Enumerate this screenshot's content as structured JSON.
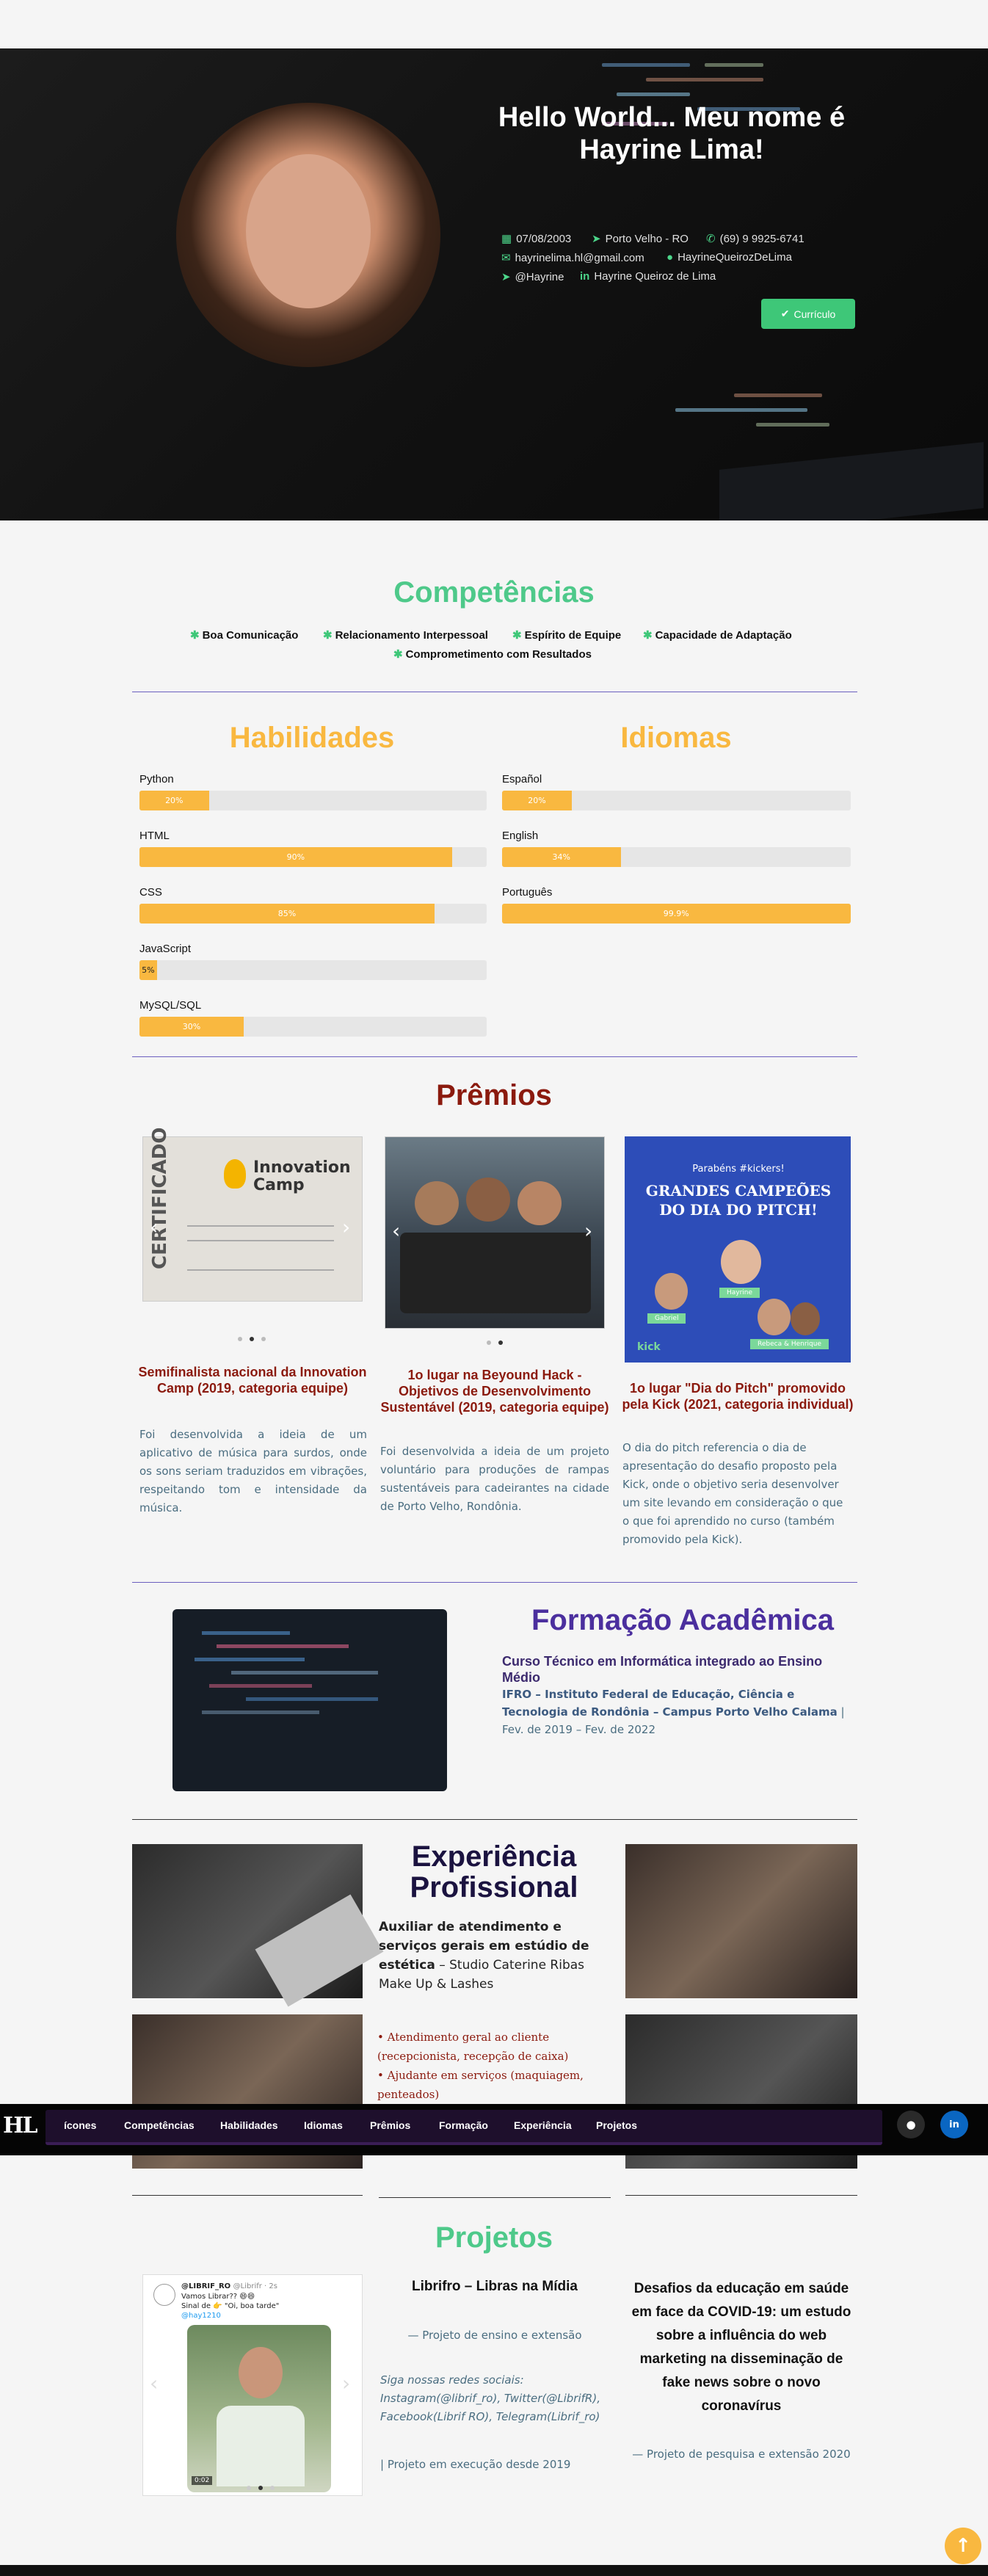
{
  "hero": {
    "title": "Hello World... Meu nome é Hayrine Lima!",
    "birth": "07/08/2003",
    "location": "Porto Velho - RO",
    "phone": "(69) 9 9925-6741",
    "email": "hayrinelima.hl@gmail.com",
    "github": "HayrineQueirozDeLima",
    "telegram": "@Hayrine",
    "linkedin": "Hayrine Queiroz de Lima",
    "cv_label": "Currículo",
    "colors": {
      "accent": "#3ec778"
    },
    "icons": [
      "calendar-icon",
      "send-icon",
      "phone-icon",
      "mail-icon",
      "github-icon",
      "telegram-icon",
      "linkedin-icon",
      "check-icon"
    ]
  },
  "competencias": {
    "title": "Competências",
    "items": [
      "Boa Comunicação",
      "Relacionamento Interpessoal",
      "Espírito de Equipe",
      "Capacidade de Adaptação",
      "Comprometimento com Resultados"
    ],
    "icon": "gear-icon",
    "color": "#4ec98a"
  },
  "habilidades": {
    "title": "Habilidades",
    "color": "#f9b840",
    "items": [
      {
        "name": "Python",
        "label": "20%",
        "percent": 20
      },
      {
        "name": "HTML",
        "label": "90%",
        "percent": 90
      },
      {
        "name": "CSS",
        "label": "85%",
        "percent": 85
      },
      {
        "name": "JavaScript",
        "label": "5%",
        "percent": 5
      },
      {
        "name": "MySQL/SQL",
        "label": "30%",
        "percent": 30
      }
    ]
  },
  "idiomas": {
    "title": "Idiomas",
    "items": [
      {
        "name": "Español",
        "label": "20%",
        "percent": 20
      },
      {
        "name": "English",
        "label": "34%",
        "percent": 34
      },
      {
        "name": "Português",
        "label": "99.9%",
        "percent": 99.9
      }
    ]
  },
  "premios": {
    "title": "Prêmios",
    "color": "#8b1a0e",
    "cards": [
      {
        "title": "Semifinalista nacional da Innovation Camp (2019, categoria equipe)",
        "text": "Foi desenvolvida a ideia de um aplicativo de música para surdos, onde os sons seriam traduzidos em vibrações, respeitando tom e intensidade da música.",
        "image_caption": "Innovation Camp",
        "image_side": "CERTIFICADO"
      },
      {
        "title": "1o lugar na Beyound Hack - Objetivos de Desenvolvimento Sustentável (2019, categoria equipe)",
        "text": "Foi desenvolvida a ideia de um projeto voluntário para produções de rampas sustentáveis para cadeirantes na cidade de Porto Velho, Rondônia."
      },
      {
        "title": "1o lugar \"Dia do Pitch\" promovido pela Kick (2021, categoria individual)",
        "text": "O dia do pitch referencia o dia de apresentação do desafio proposto pela Kick, onde o objetivo seria desenvolver um site levando em consideração o que o que foi aprendido no curso (também promovido pela Kick).",
        "image_top": "Parabéns #kickers!",
        "image_heading": "GRANDES CAMPEÕES DO DIA DO PITCH!",
        "image_brand": "kick",
        "image_badges": [
          "Hayrine",
          "Gabriel",
          "Rebeca & Henrique"
        ]
      }
    ]
  },
  "formacao": {
    "title": "Formação Acadêmica",
    "color": "#4b2f9e",
    "course": "Curso Técnico em Informática integrado ao Ensino Médio",
    "institution": "IFRO – Instituto Federal de Educação, Ciência e Tecnologia de Rondônia – Campus Porto Velho Calama",
    "period": " | Fev. de 2019 – Fev. de 2022"
  },
  "experiencia": {
    "title": "Experiência Profissional",
    "role": "Auxiliar de atendimento e serviços gerais em estúdio de estética",
    "company": " – Studio Caterine Ribas Make Up & Lashes",
    "tasks": [
      "Atendimento geral ao cliente (recepcionista, recepção de caixa)",
      "Ajudante em serviços (maquiagem, penteados)"
    ]
  },
  "nav": {
    "logo": "HL",
    "items": [
      "ícones",
      "Competências",
      "Habilidades",
      "Idiomas",
      "Prêmios",
      "Formação",
      "Experiência",
      "Projetos"
    ]
  },
  "projetos": {
    "title": "Projetos",
    "color": "#4ec98a",
    "tweet": {
      "name": "@LIBRIF_RO",
      "handle": "@Librifr · 2s",
      "line1": "Vamos Librar?? 😄😄",
      "line2": "Sinal de 👉 \"Oi, boa tarde\"",
      "mention": "@hay1210",
      "duration": "0:02"
    },
    "p1": {
      "title": "Librifro – Libras na Mídia",
      "sub": "— Projeto de ensino e extensão",
      "social_intro": "Siga nossas redes sociais:",
      "social": "Instagram(@librif_ro), Twitter(@LibrifR), Facebook(Librif RO), Telegram(Librif_ro)",
      "status": "| Projeto em execução desde 2019"
    },
    "p2": {
      "title": "Desafios da educação em saúde em face da COVID-19: um estudo sobre a influência do web marketing na disseminação de fake news sobre o novo coronavírus",
      "sub": "— Projeto de pesquisa e extensão 2020"
    }
  }
}
